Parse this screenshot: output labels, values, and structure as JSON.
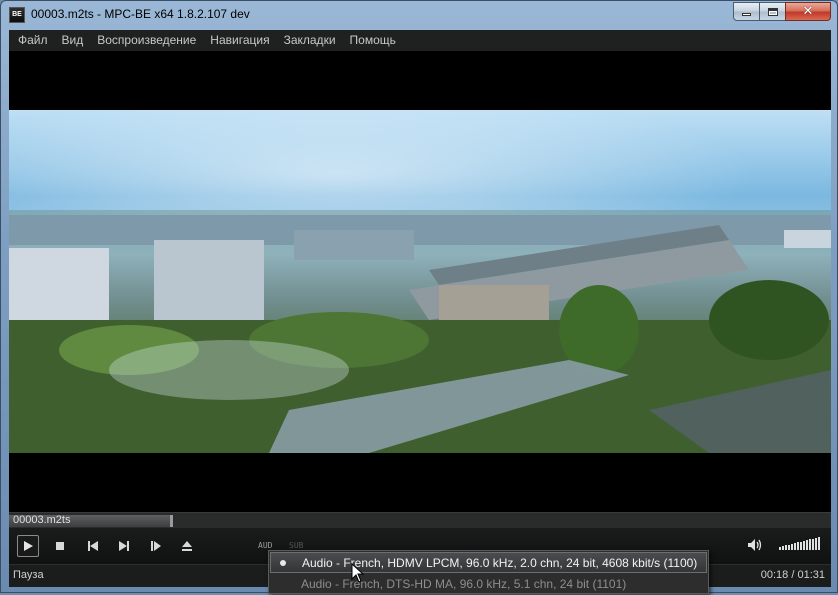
{
  "window": {
    "title": "00003.m2ts - MPC-BE x64 1.8.2.107 dev",
    "app_icon_text": "BE",
    "close_glyph": "✕"
  },
  "menu": {
    "items": [
      {
        "label": "Файл"
      },
      {
        "label": "Вид"
      },
      {
        "label": "Воспроизведение"
      },
      {
        "label": "Навигация"
      },
      {
        "label": "Закладки"
      },
      {
        "label": "Помощь"
      }
    ]
  },
  "seek": {
    "filename": "00003.m2ts",
    "progress_fraction": 0.2
  },
  "controls": {
    "aud_tag": "AUD",
    "sub_tag": "SUB",
    "volume_level": 1.0,
    "buttons": [
      "play-icon",
      "stop-icon",
      "prev-icon",
      "next-icon",
      "frame-step-icon",
      "eject-icon"
    ]
  },
  "status": {
    "state": "Пауза",
    "time": "00:18 / 01:31"
  },
  "audio_menu": {
    "items": [
      {
        "label": "Audio - French, HDMV LPCM, 96.0 kHz, 2.0 chn, 24 bit, 4608 kbit/s (1100)",
        "selected": true
      },
      {
        "label": "Audio - French, DTS-HD MA, 96.0 kHz, 5.1 chn, 24 bit (1101)",
        "selected": false
      }
    ]
  },
  "colors": {
    "menubar_bg": "#1f2020",
    "player_bg": "#000000",
    "window_frame": "#8aaacb"
  }
}
